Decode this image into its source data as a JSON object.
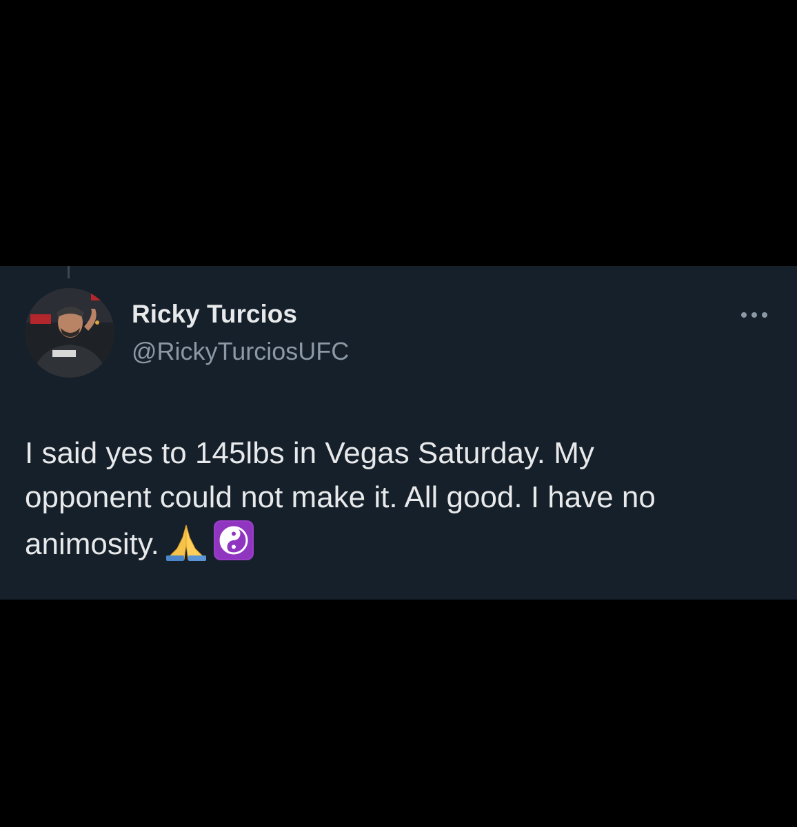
{
  "author": {
    "display_name": "Ricky Turcios",
    "handle": "@RickyTurciosUFC"
  },
  "tweet": {
    "lines": [
      "I said yes to 145lbs in Vegas Saturday. My",
      "opponent could not make it. All good. I have no",
      "animosity."
    ],
    "emojis": [
      "folded-hands-icon",
      "yin-yang-icon"
    ]
  },
  "colors": {
    "card_background": "#16202a",
    "page_background": "#000000",
    "primary_text": "#e7e9ea",
    "secondary_text": "#8b98a5"
  }
}
